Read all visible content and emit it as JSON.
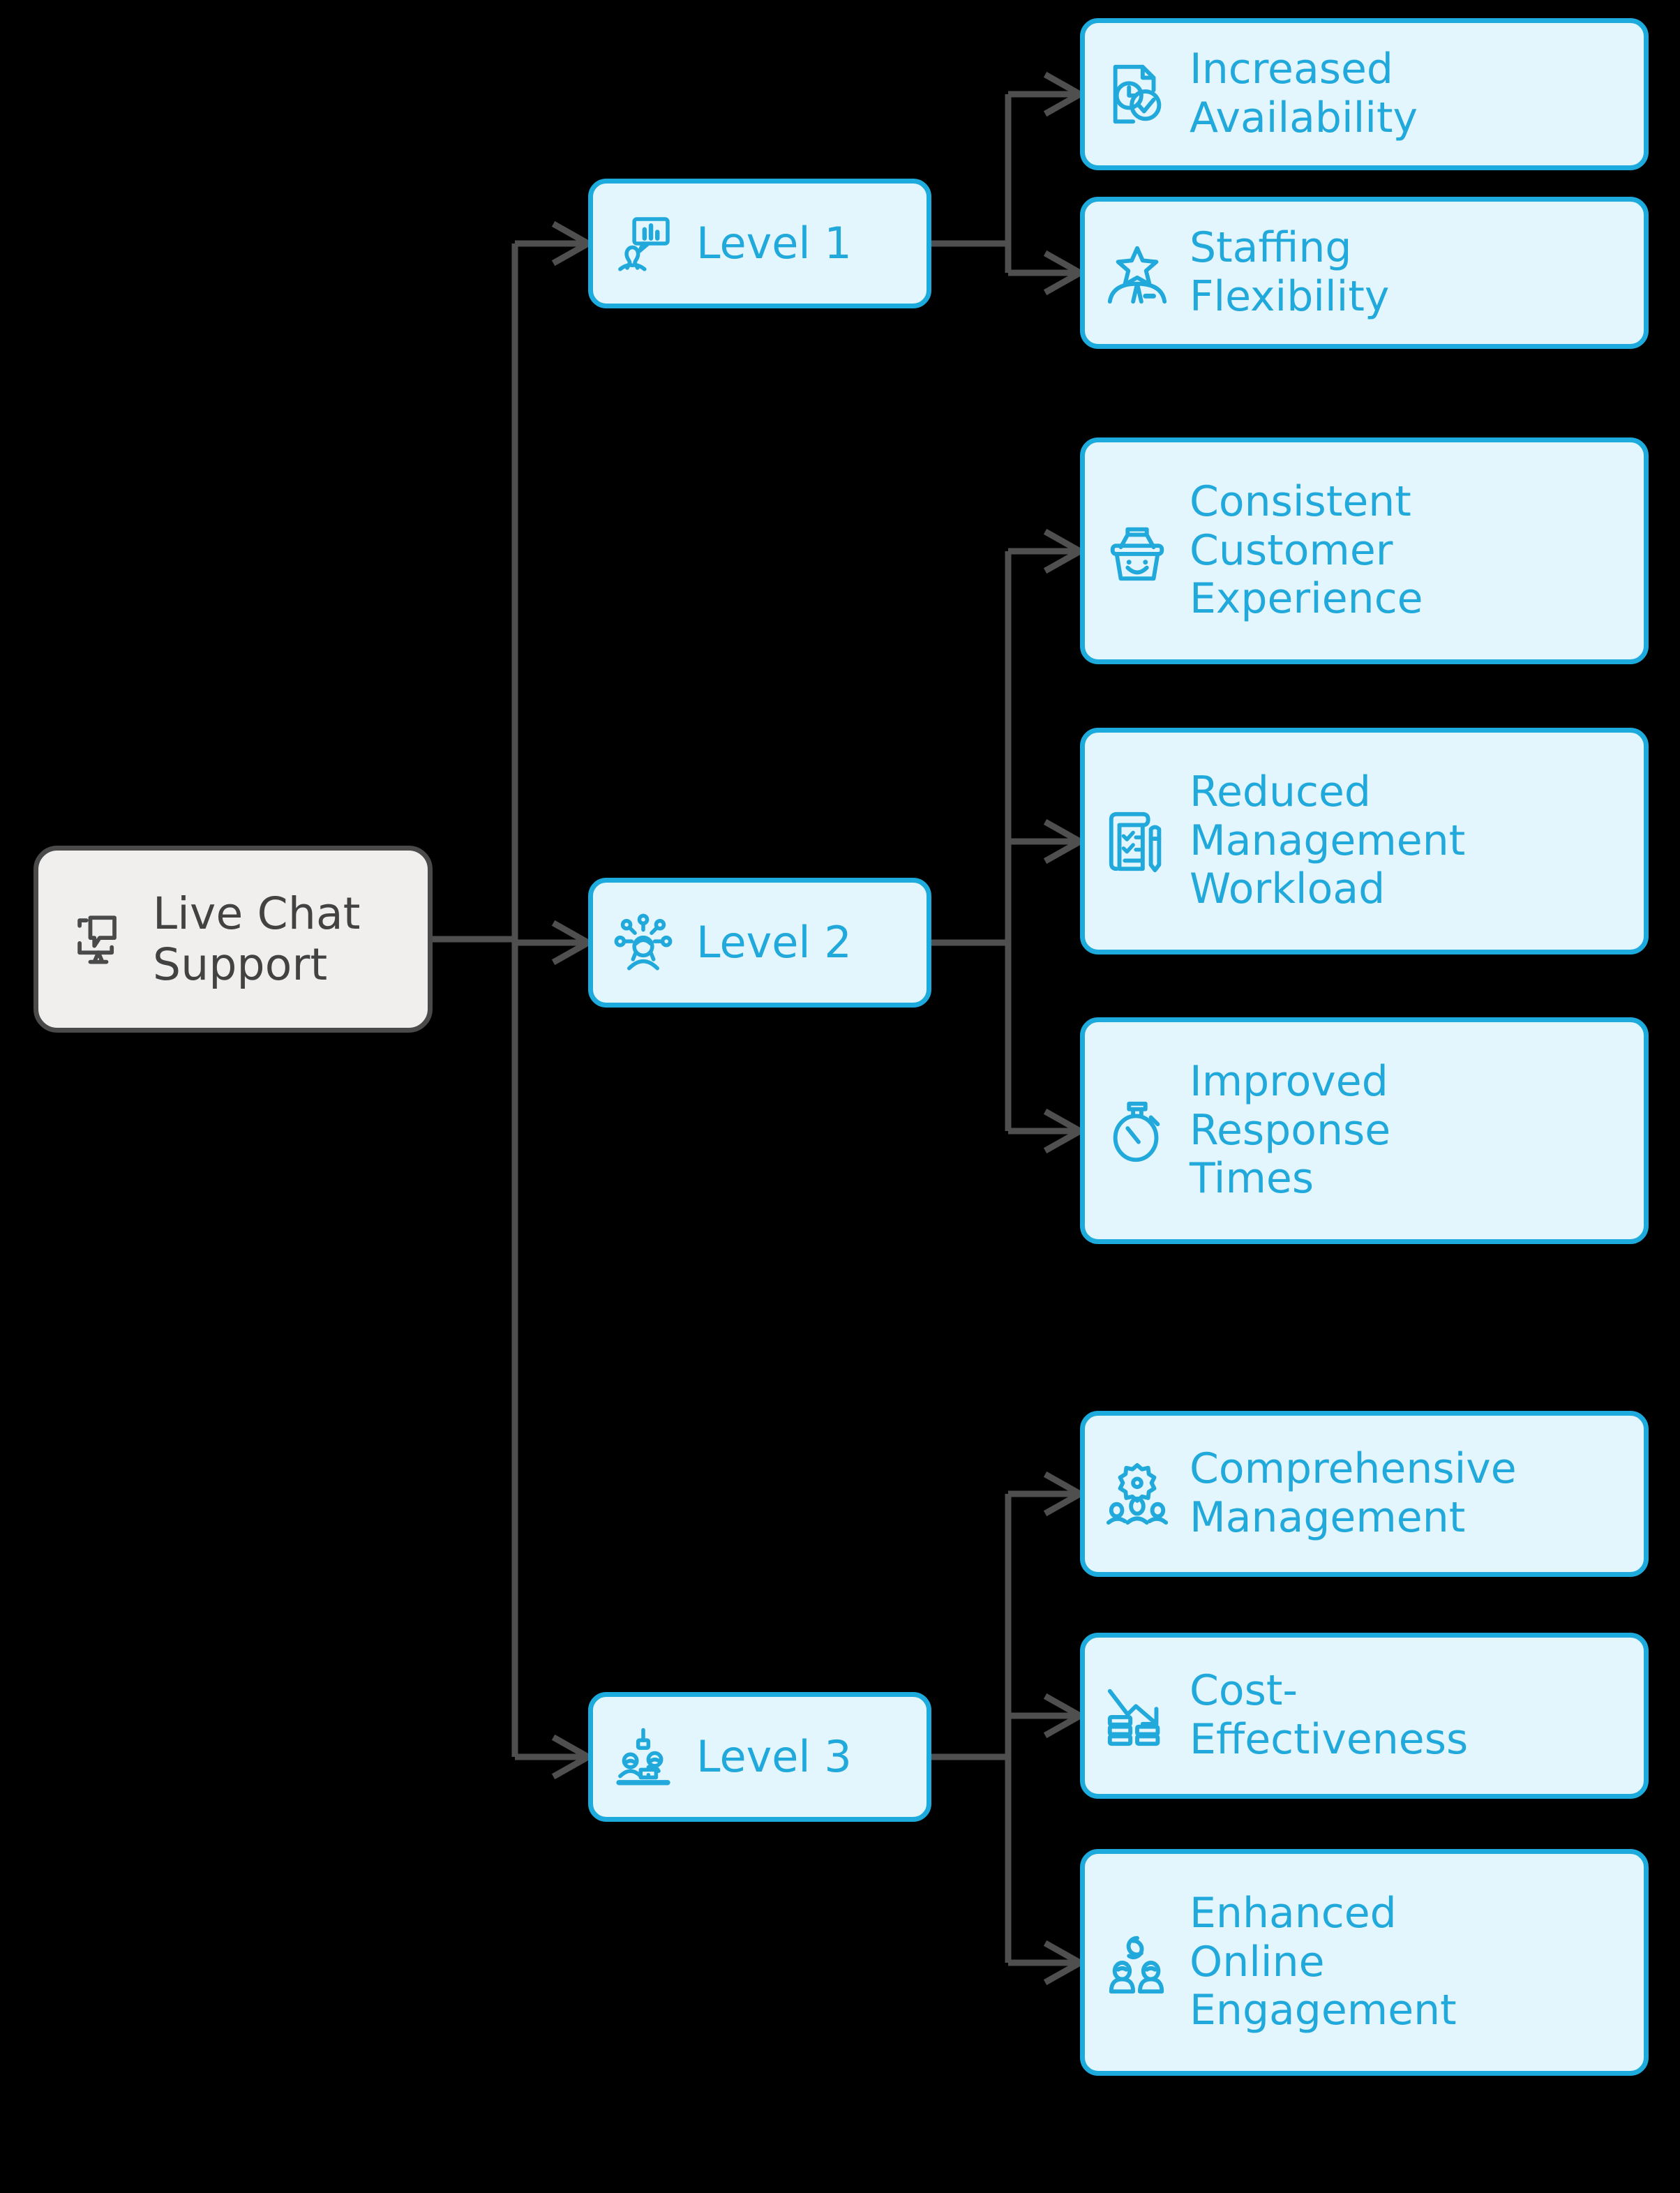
{
  "diagram": {
    "type": "mind-map",
    "background_color": "#000000",
    "accent_color": "#1cabdc",
    "node_fill_color": "#e4f6fd",
    "node_text_color": "#22a9db",
    "root_fill_color": "#f0efee",
    "root_border_color": "#4a4a4a",
    "root_text_color": "#424242",
    "connector_color": "#4f4f4f",
    "root": {
      "label": "Live Chat\nSupport",
      "icon": "monitor-chat-icon"
    },
    "branches": [
      {
        "label": "Level 1",
        "icon": "person-chat-survey-icon",
        "children": [
          {
            "label": "Increased\nAvailability",
            "icon": "document-clock-check-icon"
          },
          {
            "label": "Staffing\nFlexibility",
            "icon": "star-person-icon"
          }
        ]
      },
      {
        "label": "Level 2",
        "icon": "person-network-icon",
        "children": [
          {
            "label": "Consistent\nCustomer\nExperience",
            "icon": "smiling-basket-icon"
          },
          {
            "label": "Reduced\nManagement\nWorkload",
            "icon": "checklist-pen-icon"
          },
          {
            "label": "Improved\nResponse\nTimes",
            "icon": "stopwatch-icon"
          }
        ]
      },
      {
        "label": "Level 3",
        "icon": "team-desk-laptop-icon",
        "children": [
          {
            "label": "Comprehensive\nManagement",
            "icon": "gear-people-icon"
          },
          {
            "label": "Cost-\nEffectiveness",
            "icon": "coins-down-arrow-icon"
          },
          {
            "label": "Enhanced\nOnline\nEngagement",
            "icon": "people-link-icon"
          }
        ]
      }
    ]
  }
}
